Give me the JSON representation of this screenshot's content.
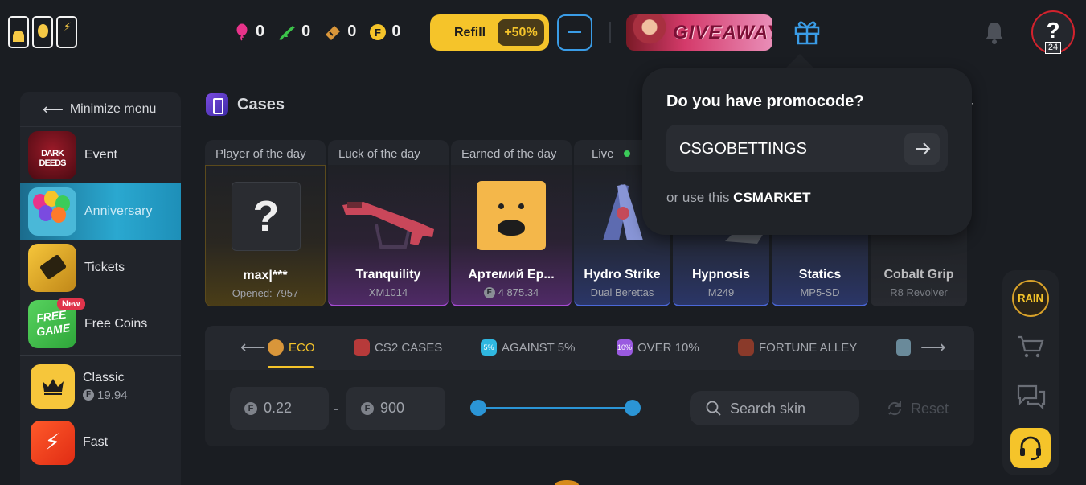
{
  "header": {
    "stats": [
      {
        "icon": "balloon-icon",
        "value": "0",
        "color": "#e8338a"
      },
      {
        "icon": "rifle-icon",
        "value": "0",
        "color": "#3cc34a"
      },
      {
        "icon": "ticket-icon",
        "value": "0",
        "color": "#d9963a"
      },
      {
        "icon": "fcoin-icon",
        "value": "0",
        "color": "#f5c42a",
        "glyph": "F"
      }
    ],
    "refill_label": "Refill",
    "refill_bonus": "+50%",
    "giveaway_label": "GIVEAWAY",
    "avatar_glyph": "?",
    "avatar_level": "24"
  },
  "sidebar": {
    "minimize_label": "Minimize menu",
    "event_art": "DARK DEEDS",
    "free_art": "FREE GAME",
    "new_badge": "New",
    "items": [
      {
        "label": "Event"
      },
      {
        "label": "Anniversary"
      },
      {
        "label": "Tickets"
      },
      {
        "label": "Free Coins"
      },
      {
        "label": "Classic",
        "price": "19.94"
      },
      {
        "label": "Fast"
      }
    ]
  },
  "main": {
    "title": "Cases",
    "top_tabs": [
      "Player of the day",
      "Luck of the day",
      "Earned of the day",
      "Live"
    ],
    "cards": [
      {
        "name": "max|***",
        "sub": "Opened: 7957"
      },
      {
        "name": "Tranquility",
        "sub": "XM1014"
      },
      {
        "name": "Артемий Ер...",
        "sub": "4 875.34"
      },
      {
        "name": "Hydro Strike",
        "sub": "Dual Berettas"
      },
      {
        "name": "Hypnosis",
        "sub": "M249"
      },
      {
        "name": "Statics",
        "sub": "MP5-SD"
      },
      {
        "name": "Cobalt Grip",
        "sub": "R8 Revolver"
      }
    ],
    "categories": [
      "ECO",
      "CS2 CASES",
      "AGAINST 5%",
      "OVER 10%",
      "FORTUNE ALLEY"
    ],
    "category_badges": {
      "against": "5%",
      "over": "10%"
    },
    "filter": {
      "price_min": "0.22",
      "price_max": "900",
      "dash": "-",
      "search_placeholder": "Search skin",
      "reset_label": "Reset",
      "range_low": 0,
      "range_high": 1
    },
    "sort_hint": "y"
  },
  "promo": {
    "title": "Do you have promocode?",
    "code_value": "CSGOBETTINGS",
    "hint_prefix": "or use this",
    "hint_code": "CSMARKET"
  },
  "rail": {
    "rain_label": "RAIN"
  },
  "colors": {
    "accent": "#f5c42a",
    "blue": "#2b95d6",
    "bg": "#1a1d22"
  }
}
